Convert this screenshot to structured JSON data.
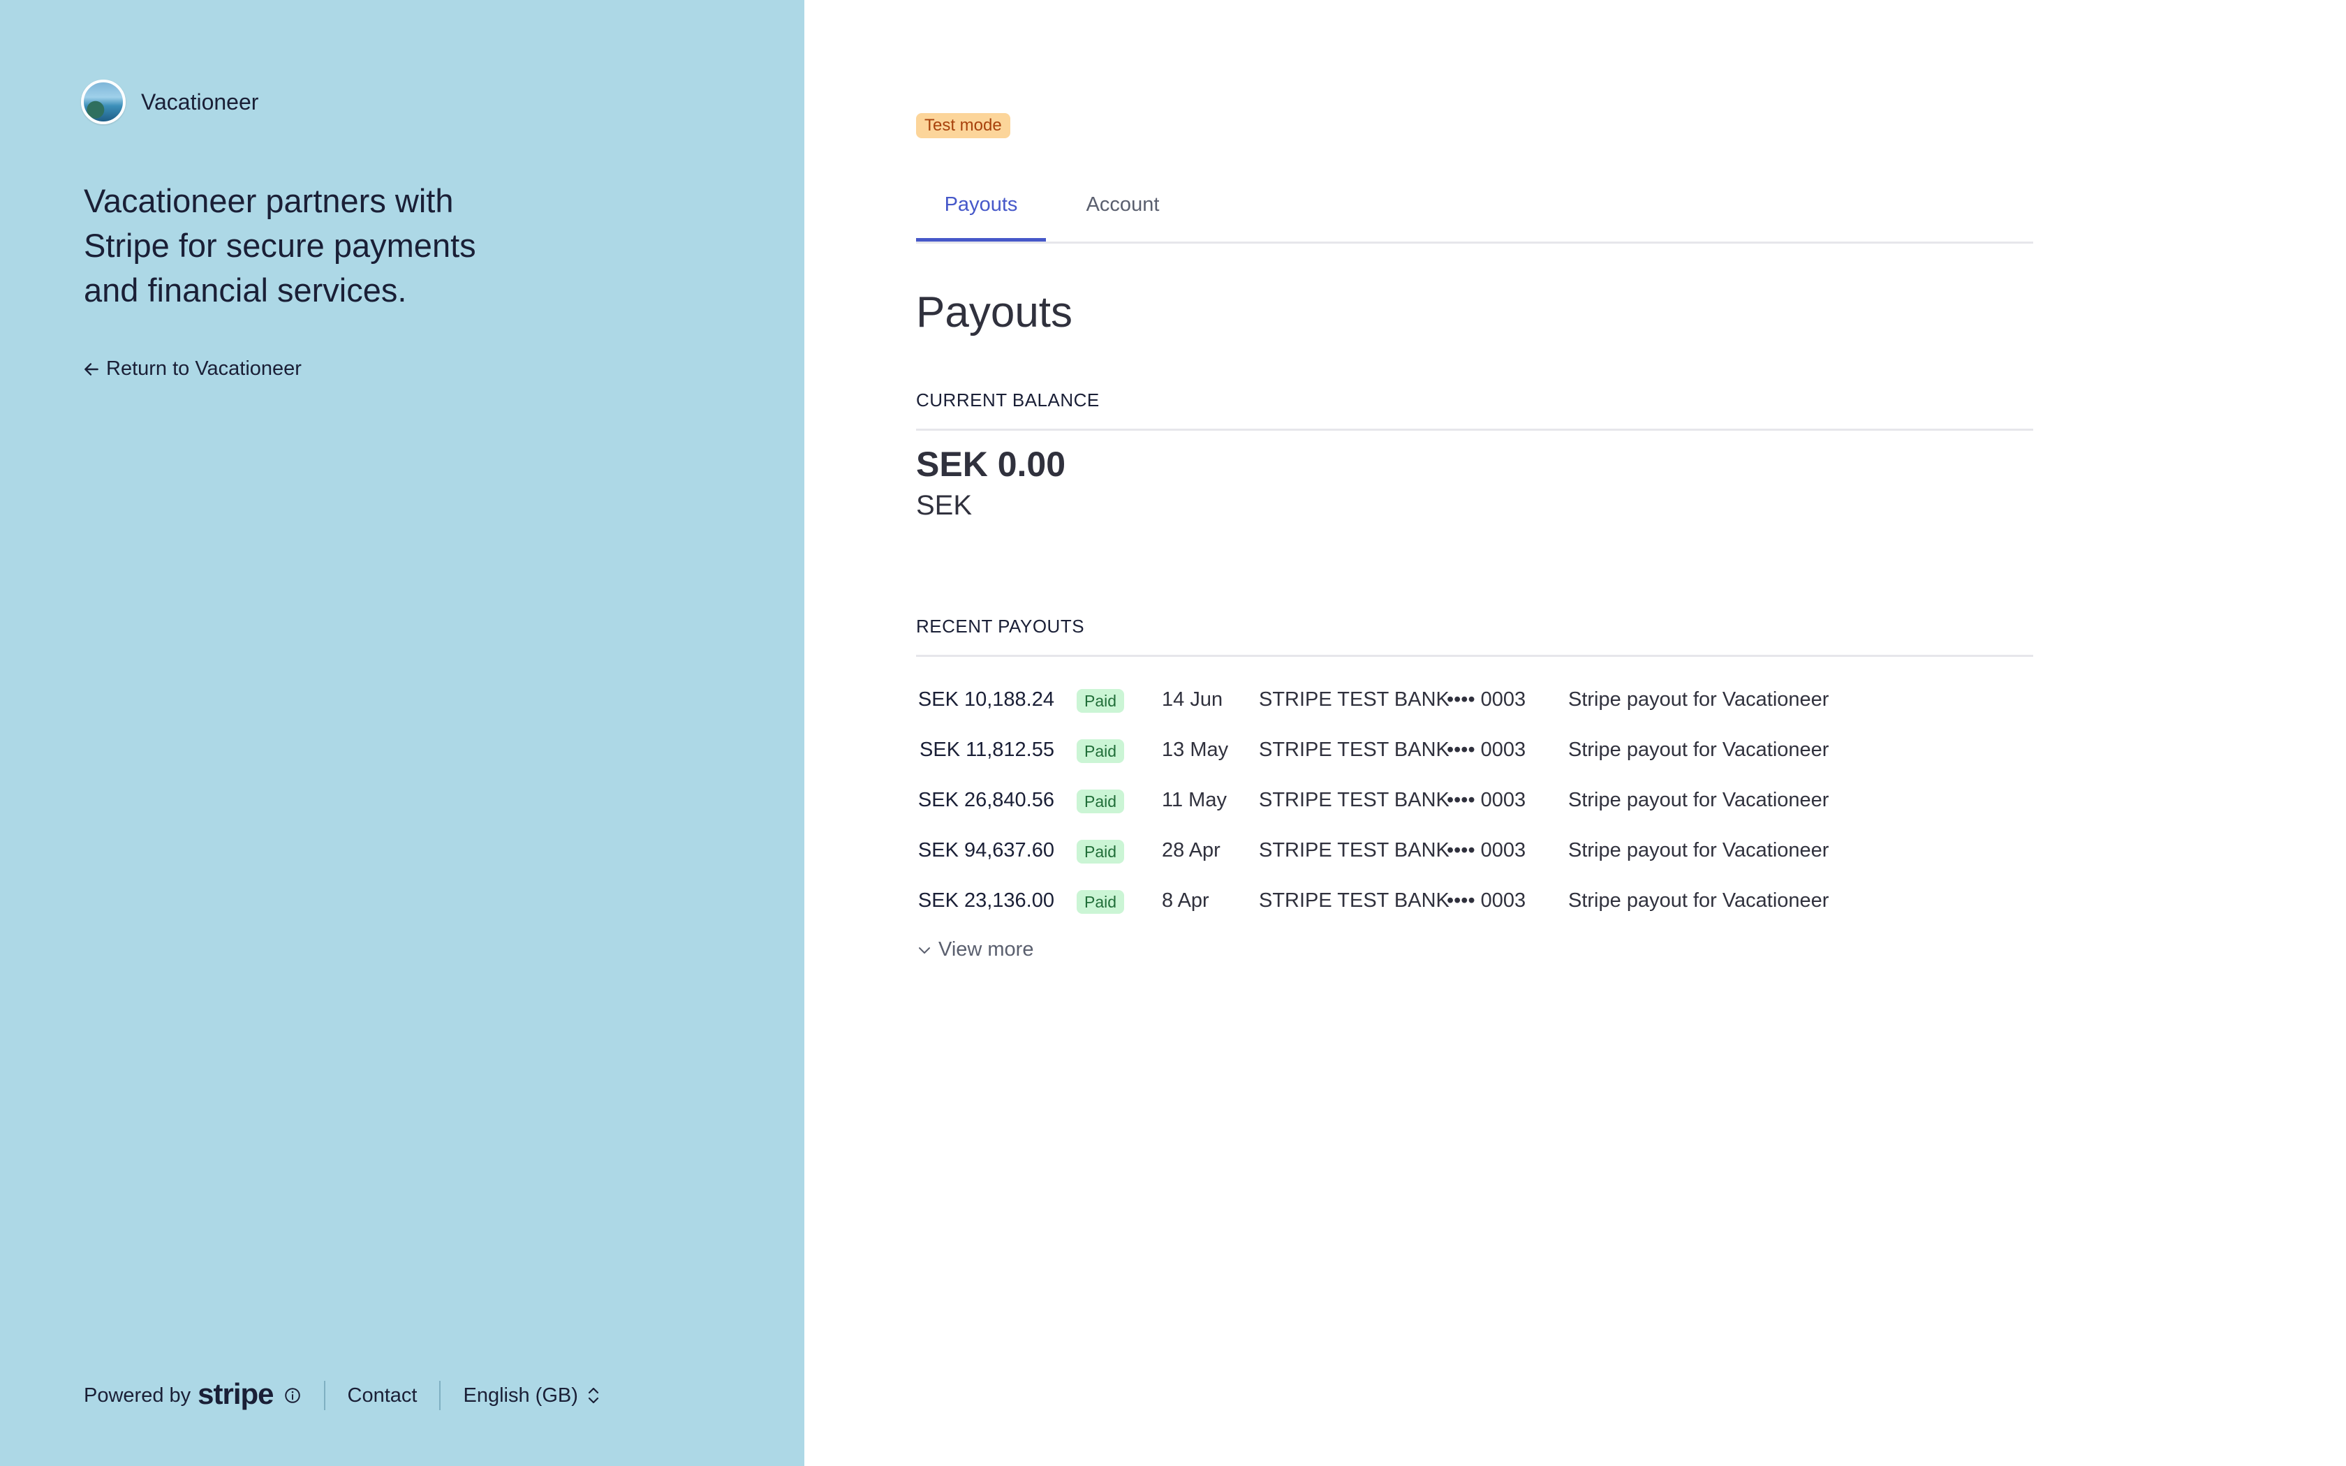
{
  "sidebar": {
    "brand_name": "Vacationeer",
    "tagline": "Vacationeer partners with Stripe for secure payments and financial services.",
    "return_label": "Return to Vacationeer",
    "footer": {
      "powered_by": "Powered by",
      "stripe": "stripe",
      "contact": "Contact",
      "language": "English (GB)"
    },
    "background_color": "#add8e6"
  },
  "main": {
    "badge": "Test mode",
    "tabs": [
      {
        "label": "Payouts",
        "active": true
      },
      {
        "label": "Account",
        "active": false
      }
    ],
    "title": "Payouts",
    "balance": {
      "label": "CURRENT BALANCE",
      "amount": "SEK 0.00",
      "currency": "SEK"
    },
    "recent": {
      "label": "RECENT PAYOUTS",
      "rows": [
        {
          "amount": "SEK 10,188.24",
          "status": "Paid",
          "date": "14 Jun",
          "bank": "STRIPE TEST BANK",
          "last4": "•••• 0003",
          "description": "Stripe payout for Vacationeer"
        },
        {
          "amount": "SEK 11,812.55",
          "status": "Paid",
          "date": "13 May",
          "bank": "STRIPE TEST BANK",
          "last4": "•••• 0003",
          "description": "Stripe payout for Vacationeer"
        },
        {
          "amount": "SEK 26,840.56",
          "status": "Paid",
          "date": "11 May",
          "bank": "STRIPE TEST BANK",
          "last4": "•••• 0003",
          "description": "Stripe payout for Vacationeer"
        },
        {
          "amount": "SEK 94,637.60",
          "status": "Paid",
          "date": "28 Apr",
          "bank": "STRIPE TEST BANK",
          "last4": "•••• 0003",
          "description": "Stripe payout for Vacationeer"
        },
        {
          "amount": "SEK 23,136.00",
          "status": "Paid",
          "date": "8 Apr",
          "bank": "STRIPE TEST BANK",
          "last4": "•••• 0003",
          "description": "Stripe payout for Vacationeer"
        }
      ],
      "view_more": "View more"
    },
    "accent_color": "#4658c9"
  }
}
